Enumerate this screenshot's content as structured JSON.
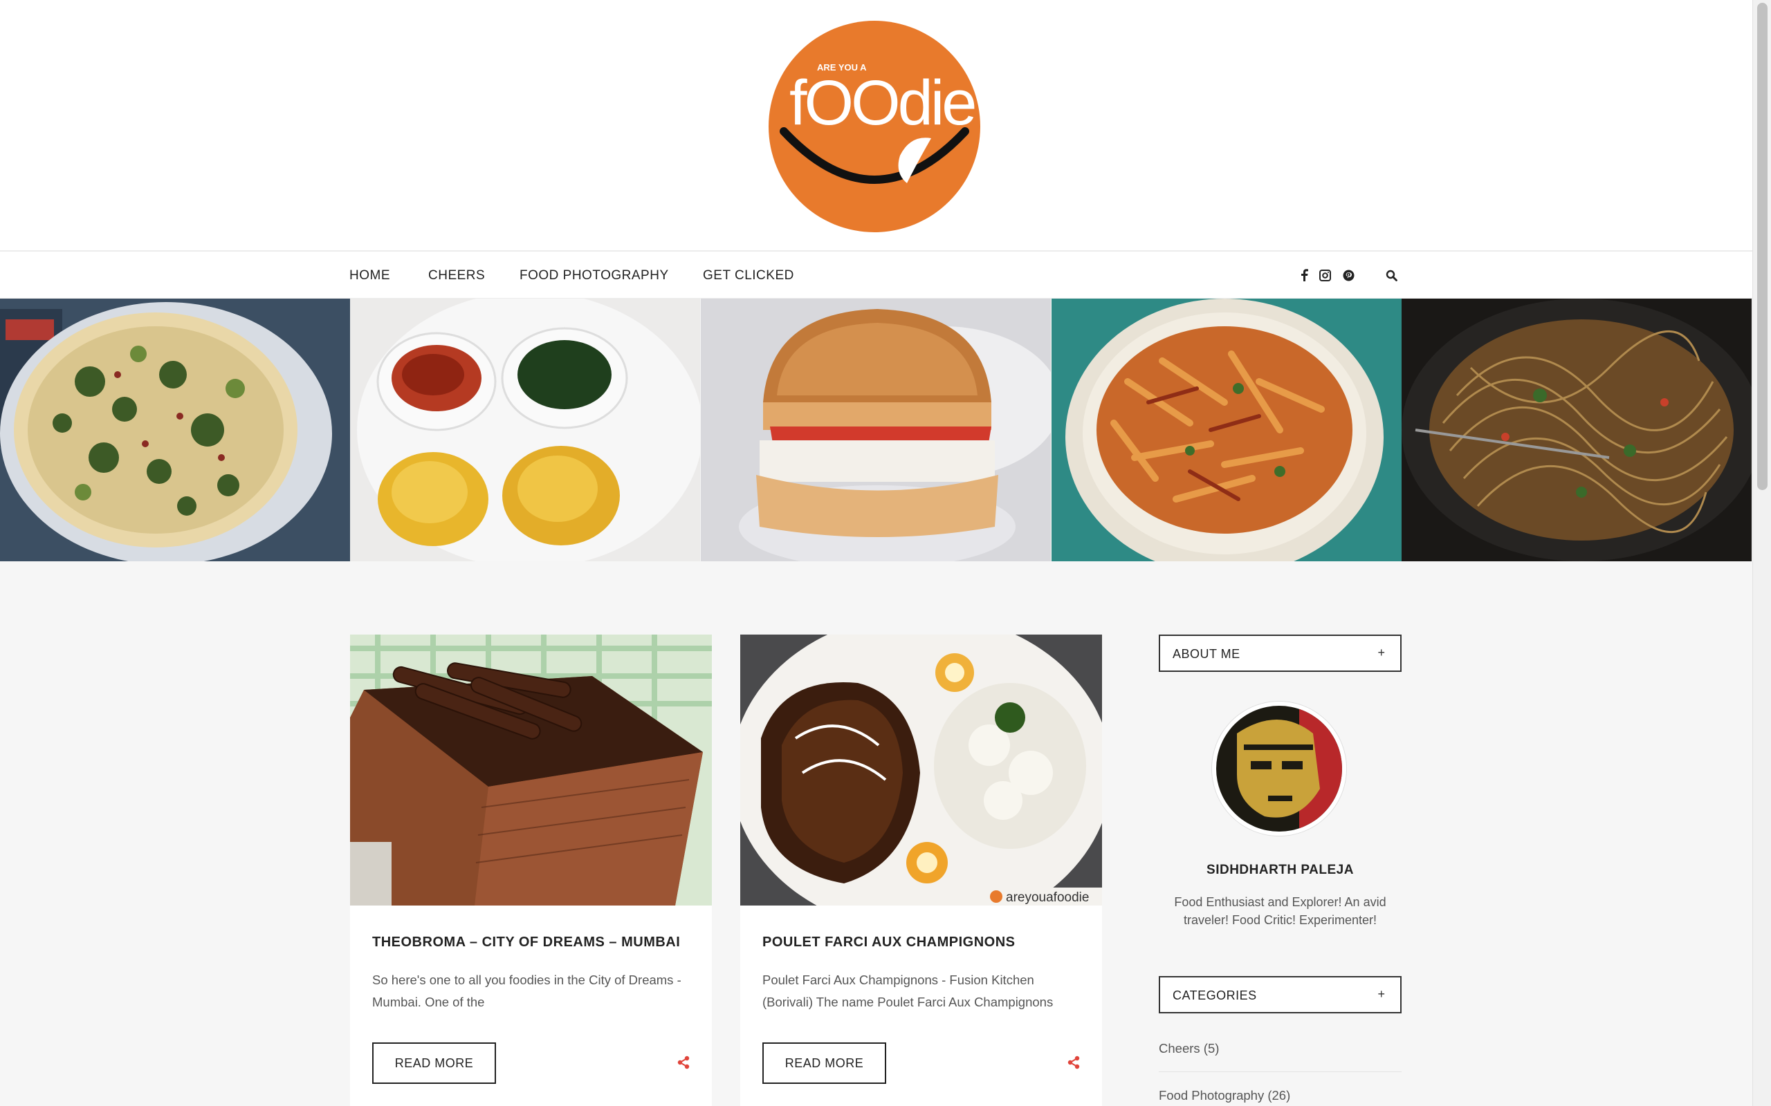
{
  "logo": {
    "line_small": "ARE YOU A",
    "line_big": "fOOdie",
    "color": "#E87A2C"
  },
  "nav": {
    "items": [
      "HOME",
      "CHEERS",
      "FOOD PHOTOGRAPHY",
      "GET CLICKED"
    ],
    "icons": [
      "facebook-icon",
      "instagram-icon",
      "pinterest-icon",
      "search-icon"
    ]
  },
  "slider": {
    "slides": [
      "pizza",
      "vada-with-chutneys",
      "burger",
      "stir-fried-noodles",
      "hakka-noodles"
    ]
  },
  "posts": [
    {
      "title": "THEOBROMA – CITY OF DREAMS – MUMBAI",
      "excerpt": "So here's one to all you foodies in the City of Dreams - Mumbai. One of the",
      "button": "READ MORE"
    },
    {
      "title": "POULET FARCI AUX CHAMPIGNONS",
      "excerpt": "Poulet Farci Aux Champignons - Fusion Kitchen (Borivali) The name Poulet Farci Aux Champignons",
      "button": "READ MORE",
      "watermark": "areyouafoodie"
    }
  ],
  "sidebar": {
    "about": {
      "title": "ABOUT ME",
      "plus": "+",
      "name": "SIDHDHARTH PALEJA",
      "bio": "Food Enthusiast and Explorer! An avid traveler! Food Critic! Experimenter!"
    },
    "categories": {
      "title": "CATEGORIES",
      "plus": "+",
      "items": [
        "Cheers (5)",
        "Food Photography (26)"
      ]
    }
  },
  "colors": {
    "accent": "#E87A2C",
    "share": "#E0443B"
  }
}
